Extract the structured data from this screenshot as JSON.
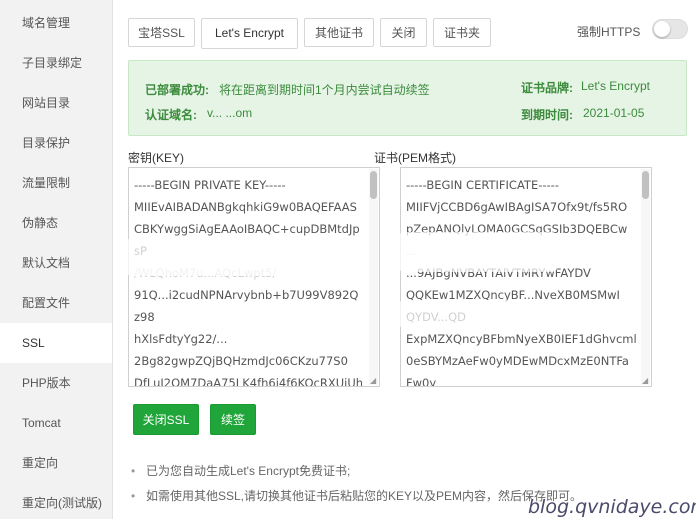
{
  "sidebar": {
    "items": [
      {
        "label": "域名管理"
      },
      {
        "label": "子目录绑定"
      },
      {
        "label": "网站目录"
      },
      {
        "label": "目录保护"
      },
      {
        "label": "流量限制"
      },
      {
        "label": "伪静态"
      },
      {
        "label": "默认文档"
      },
      {
        "label": "配置文件"
      },
      {
        "label": "SSL"
      },
      {
        "label": "PHP版本"
      },
      {
        "label": "Tomcat"
      },
      {
        "label": "重定向"
      },
      {
        "label": "重定向(测试版)"
      }
    ],
    "active_index": 8
  },
  "tabs": [
    {
      "label": "宝塔SSL"
    },
    {
      "label": "Let's Encrypt"
    },
    {
      "label": "其他证书"
    },
    {
      "label": "关闭"
    },
    {
      "label": "证书夹"
    }
  ],
  "active_tab": 1,
  "force_https": {
    "label": "强制HTTPS",
    "enabled": false
  },
  "info": {
    "status_label": "已部署成功:",
    "status_text": "将在距离到期时间1个月内尝试自动续签",
    "domain_label": "认证域名:",
    "domain_value": "v... ...om",
    "brand_label": "证书品牌:",
    "brand_value": "Let's Encrypt",
    "expiry_label": "到期时间:",
    "expiry_value": "2021-01-05"
  },
  "key": {
    "label": "密钥(KEY)",
    "lines": [
      "-----BEGIN PRIVATE KEY-----",
      "MIIEvAIBADANBgkqhkiG9w0BAQEFAAS",
      "CBKYwggSiAgEAAoIBAQC+cupDBMtdJp",
      "sP",
      "/WLQhoM7u...AQcLwpt5/",
      "91Q...i2cudNPNArvybnb+b7U99V892Q",
      "z98",
      "hXlsFdtyYg22/...",
      "2Bg82gwpZQjBQHzmdJc06CKzu77S0",
      "DfLuI2OM7DaA75LK4fh6i4f6KOcRXUiUh"
    ]
  },
  "cert": {
    "label": "证书(PEM格式)",
    "lines": [
      "-----BEGIN CERTIFICATE-----",
      "MIIFVjCCBD6gAwIBAgISA7Ofx9t/fs5RO",
      "pZepANQlyLOMA0GCSqGSIb3DQEBCw",
      "...",
      "...9AJBgNVBAYTAlVTMRYwFAYDV",
      "QQKEw1MZXQncyBF...NveXB0MSMwI",
      "QYDV...QD",
      "ExpMZXQncyBFbmNyeXB0IEF1dGhvcml",
      "0eSBYMzAeFw0yMDEwMDcxMzE0NTFa",
      "Fw0y"
    ]
  },
  "buttons": {
    "close_ssl": "关闭SSL",
    "renew": "续签"
  },
  "notes": [
    "已为您自动生成Let's Encrypt免费证书;",
    "如需使用其他SSL,请切换其他证书后粘贴您的KEY以及PEM内容，然后保存即可。"
  ],
  "watermark": "blog.qvnidaye.com",
  "colors": {
    "accent": "#20a53a",
    "info_bg": "#e6f4e6",
    "info_text": "#3c8b3c"
  }
}
